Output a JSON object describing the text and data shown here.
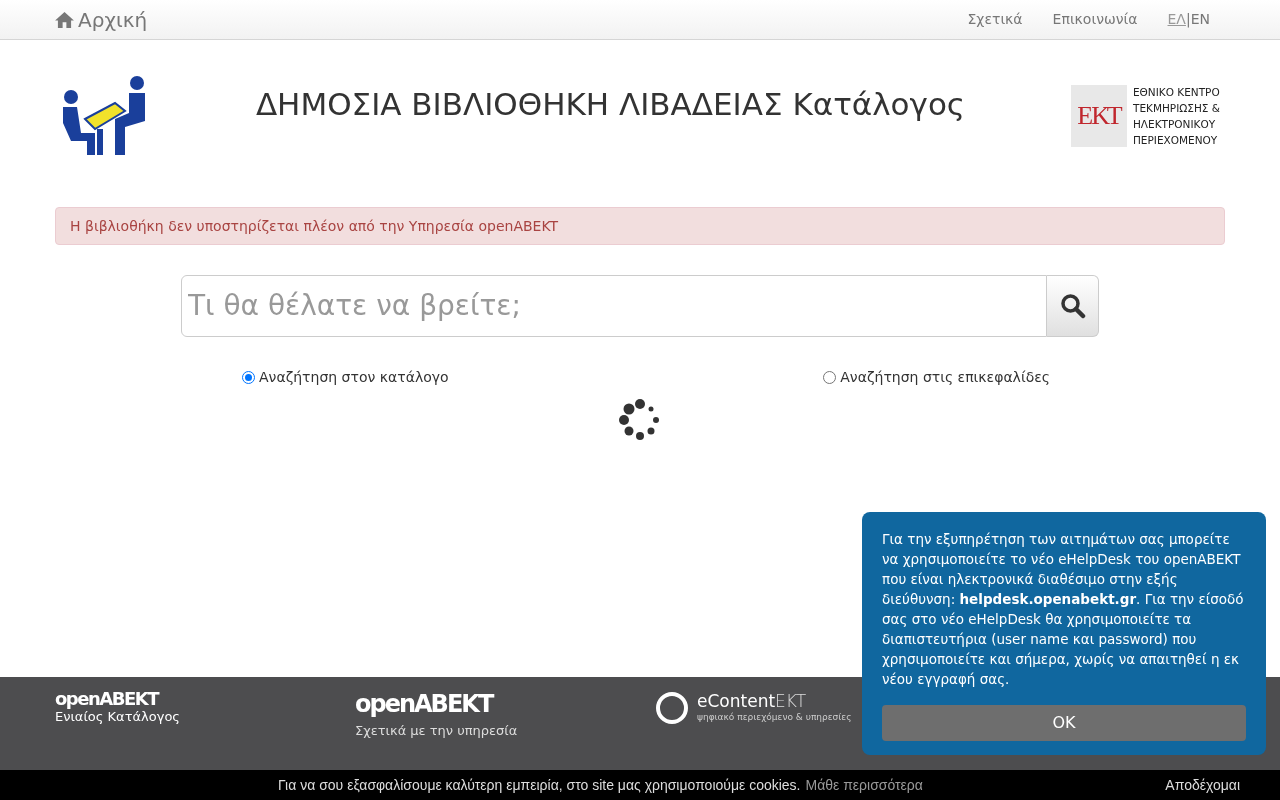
{
  "navbar": {
    "home": "Αρχική",
    "links": [
      {
        "label": "Σχετικά"
      },
      {
        "label": "Επικοινωνία"
      }
    ],
    "languages": [
      {
        "label": "ΕΛ",
        "selected": true
      },
      {
        "label": "EN",
        "selected": false
      }
    ],
    "separator": "|"
  },
  "header": {
    "title": "ΔΗΜΟΣΙΑ ΒΙΒΛΙΟΘΗΚΗ ΛΙΒΑΔΕΙΑΣ Κατάλογος",
    "ekt_logo": {
      "mark": "ΕΚΤ",
      "lines": [
        "ΕΘΝΙΚΟ ΚΕΝΤΡΟ",
        "ΤΕΚΜΗΡΙΩΣΗΣ &",
        "ΗΛΕΚΤΡΟΝΙΚΟΥ",
        "ΠΕΡΙΕΧΟΜΕΝΟΥ"
      ]
    }
  },
  "alert": "Η βιβλιοθήκη δεν υποστηρίζεται πλέον από την Υπηρεσία openABEKT",
  "search": {
    "placeholder": "Τι θα θέλατε να βρείτε;"
  },
  "search_modes": [
    {
      "label": "Αναζήτηση στον κατάλογο",
      "selected": true
    },
    {
      "label": "Αναζήτηση στις επικεφαλίδες",
      "selected": false
    }
  ],
  "footer": [
    {
      "kind": "brand",
      "title": "openABEKT",
      "subtitle": "Ενιαίος Κατάλογος"
    },
    {
      "kind": "brand_large",
      "title": "openABEKT",
      "subtitle": "Σχετικά με την υπηρεσία"
    },
    {
      "kind": "econtent",
      "title": "eContent",
      "title_light": "EKT",
      "subtitle": "ψηφιακό περιεχόμενο & υπηρεσίες"
    }
  ],
  "cookie_bar": {
    "text": "Για να σου εξασφαλίσουμε καλύτερη εμπειρία, στο site μας χρησιμοποιούμε cookies.",
    "link": "Μάθε περισσότερα",
    "accept": "Αποδέχομαι"
  },
  "popup": {
    "message": "Για την εξυπηρέτηση των αιτημάτων σας μπορείτε να χρησιμοποιείτε το νέο eHelpDesk του openABEKT που είναι ηλεκτρονικά διαθέσιμο στην εξής διεύθυνση: **helpdesk.openabekt.gr**. Για την είσοδό σας στο νέο eHelpDesk θα χρησιμοποιείτε τα διαπιστευτήρια (user name και password) που χρησιμοποιείτε και σήμερα, χωρίς να απαιτηθεί η εκ νέου εγγραφή σας.",
    "button": "OK"
  }
}
